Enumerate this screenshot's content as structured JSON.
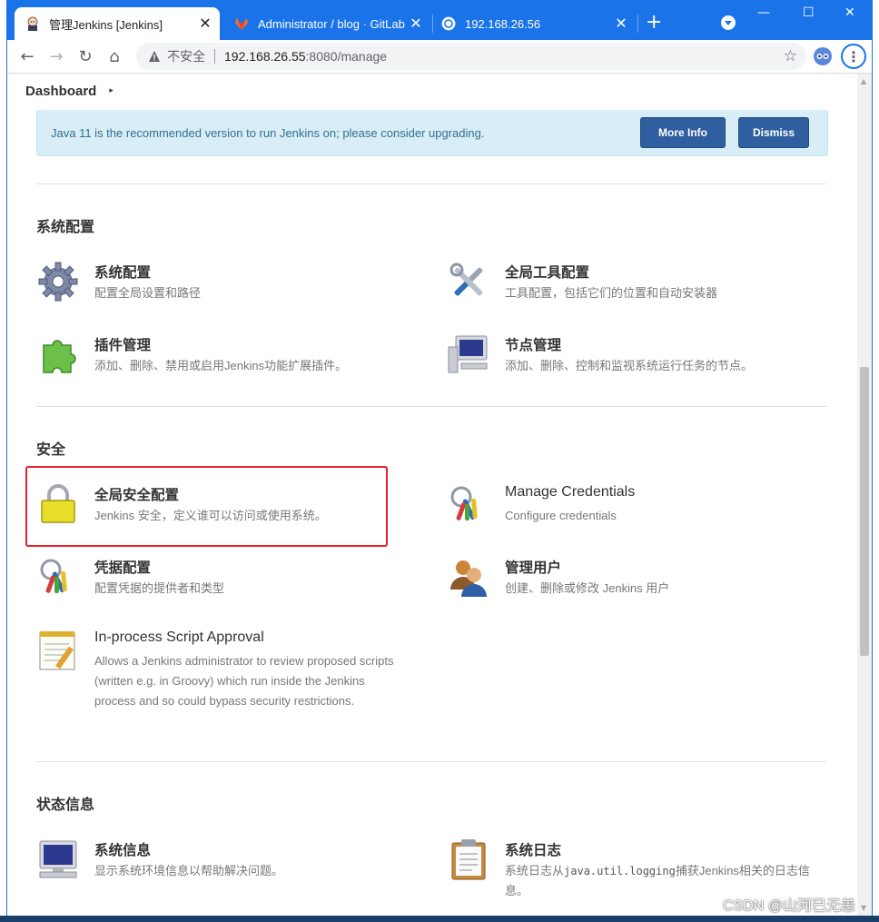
{
  "browser": {
    "tabs": [
      {
        "title": "管理Jenkins [Jenkins]",
        "active": true,
        "close": "✕"
      },
      {
        "title": "Administrator / blog · GitLab",
        "active": false,
        "close": "✕"
      },
      {
        "title": "192.168.26.56",
        "active": false,
        "close": "✕"
      }
    ],
    "new_tab": "+",
    "window_controls": {
      "minimize": "—",
      "maximize": "☐",
      "close": "✕"
    },
    "nav": {
      "back": "←",
      "forward": "→",
      "reload": "↻",
      "home": "⌂"
    },
    "omnibox": {
      "security_text": "不安全",
      "url_host": "192.168.26.55",
      "url_rest": ":8080/manage"
    },
    "bookmark": "☆",
    "menu": "⋮",
    "accent_color": "#1a73e8"
  },
  "page": {
    "breadcrumb": {
      "label": "Dashboard",
      "arrow": "▸"
    },
    "banner": {
      "message": "Java 11 is the recommended version to run Jenkins on; please consider upgrading.",
      "more_info": "More Info",
      "dismiss": "Dismiss"
    },
    "sections": [
      {
        "title": "系统配置",
        "items": [
          {
            "icon": "gear-icon",
            "title": "系统配置",
            "desc": "配置全局设置和路径"
          },
          {
            "icon": "tools-icon",
            "title": "全局工具配置",
            "desc": "工具配置，包括它们的位置和自动安装器"
          },
          {
            "icon": "plugin-icon",
            "title": "插件管理",
            "desc": "添加、删除、禁用或启用Jenkins功能扩展插件。"
          },
          {
            "icon": "computer-icon",
            "title": "节点管理",
            "desc": "添加、删除、控制和监视系统运行任务的节点。"
          }
        ]
      },
      {
        "title": "安全",
        "items": [
          {
            "icon": "lock-icon",
            "title": "全局安全配置",
            "desc": "Jenkins 安全，定义谁可以访问或使用系统。"
          },
          {
            "icon": "credentials-icon",
            "title": "Manage Credentials",
            "desc": "Configure credentials"
          },
          {
            "icon": "keys-icon",
            "title": "凭据配置",
            "desc": "配置凭据的提供者和类型"
          },
          {
            "icon": "users-icon",
            "title": "管理用户",
            "desc": "创建、删除或修改 Jenkins 用户"
          },
          {
            "icon": "notepad-icon",
            "title": "In-process Script Approval",
            "desc": "Allows a Jenkins administrator to review proposed scripts (written e.g. in Groovy) which run inside the Jenkins process and so could bypass security restrictions."
          }
        ]
      },
      {
        "title": "状态信息",
        "items": [
          {
            "icon": "monitor-icon",
            "title": "系统信息",
            "desc": "显示系统环境信息以帮助解决问题。"
          },
          {
            "icon": "clipboard-icon",
            "title": "系统日志",
            "desc_pre": "系统日志从",
            "desc_code": "java.util.logging",
            "desc_post": "捕获Jenkins相关的日志信息。"
          }
        ]
      }
    ]
  },
  "watermark": "CSDN @山河已无恙",
  "highlight_color": "#e8212a"
}
